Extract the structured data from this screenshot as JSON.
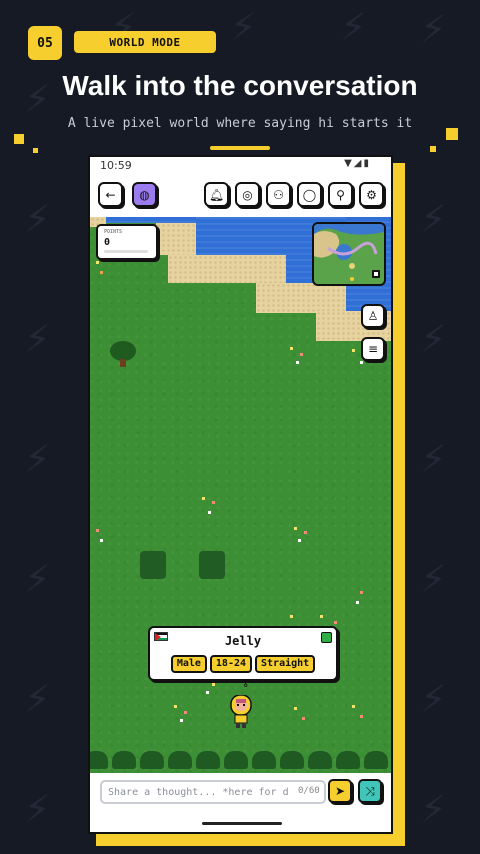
{
  "step": {
    "number": "05",
    "label": "WORLD MODE"
  },
  "headline": "Walk into the conversation",
  "subline": "A live pixel world where saying hi starts it",
  "colors": {
    "brand_yellow": "#f6cf2f",
    "background": "#161a24",
    "accent_purple": "#9b7cf0",
    "accent_teal": "#3fc6b8",
    "grass": "#3c8f34",
    "water": "#2f6fd6",
    "sand": "#e6d3a0",
    "online": "#2fae47"
  },
  "phone": {
    "status": {
      "time": "10:59",
      "icons": [
        "wifi-icon",
        "signal-icon",
        "battery-icon"
      ]
    },
    "topbar": {
      "left": [
        {
          "name": "back-button",
          "icon": "arrow-left-icon"
        },
        {
          "name": "world-toggle-button",
          "icon": "globe-icon"
        }
      ],
      "right": [
        {
          "name": "notifications-button",
          "icon": "bell-icon"
        },
        {
          "name": "explore-button",
          "icon": "compass-icon"
        },
        {
          "name": "friends-button",
          "icon": "people-icon"
        },
        {
          "name": "chat-button",
          "icon": "chat-bubble-icon"
        },
        {
          "name": "profile-button",
          "icon": "person-icon"
        },
        {
          "name": "settings-button",
          "icon": "gear-icon"
        }
      ]
    },
    "points": {
      "label": "POINTS",
      "value": "0"
    },
    "map_controls": [
      {
        "name": "outfit-button",
        "icon": "shirt-icon"
      },
      {
        "name": "menu-button",
        "icon": "list-icon"
      }
    ],
    "nearby_user": {
      "name": "Jelly",
      "flag": "palestine-flag",
      "online": true,
      "tags": [
        "Male",
        "18-24",
        "Straight"
      ]
    },
    "composer": {
      "placeholder": "Share a thought... *here for deep talk",
      "char_count": "0/60",
      "send_icon": "send-icon",
      "shuffle_icon": "shuffle-icon"
    }
  }
}
